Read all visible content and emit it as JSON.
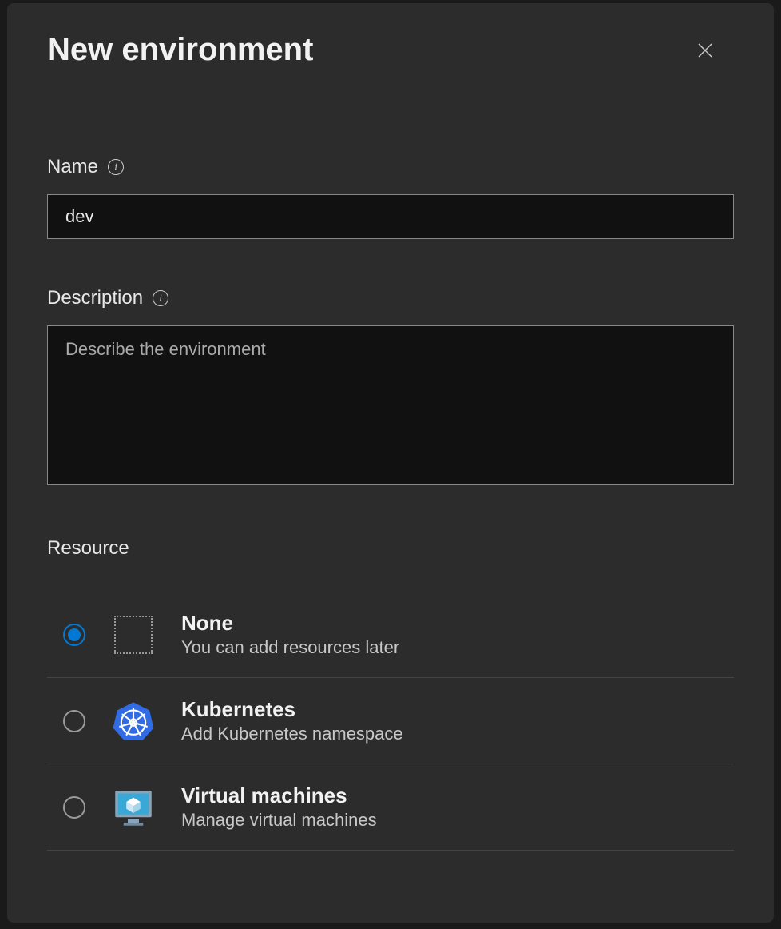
{
  "dialog": {
    "title": "New environment"
  },
  "fields": {
    "name": {
      "label": "Name",
      "value": "dev"
    },
    "description": {
      "label": "Description",
      "placeholder": "Describe the environment",
      "value": ""
    }
  },
  "resource": {
    "label": "Resource",
    "options": [
      {
        "title": "None",
        "desc": "You can add resources later",
        "selected": true
      },
      {
        "title": "Kubernetes",
        "desc": "Add Kubernetes namespace",
        "selected": false
      },
      {
        "title": "Virtual machines",
        "desc": "Manage virtual machines",
        "selected": false
      }
    ]
  }
}
